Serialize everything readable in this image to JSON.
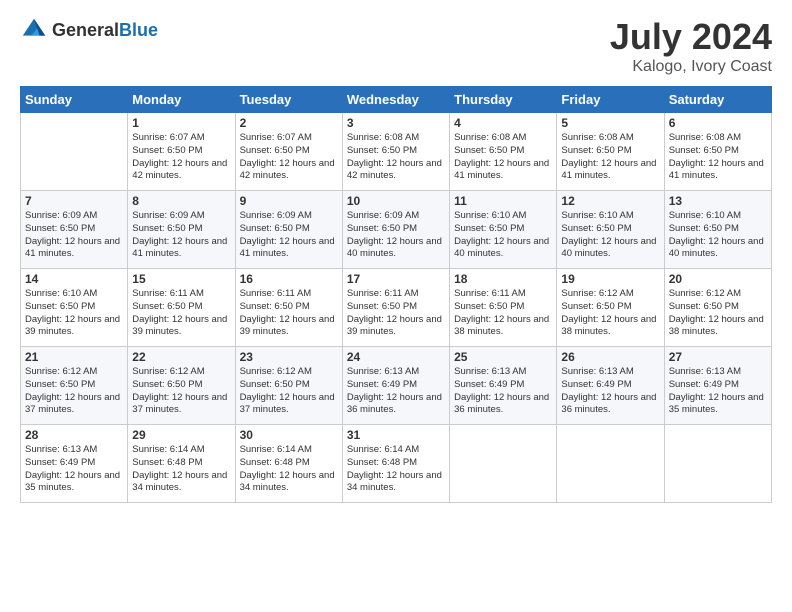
{
  "header": {
    "logo_general": "General",
    "logo_blue": "Blue",
    "month_year": "July 2024",
    "location": "Kalogo, Ivory Coast"
  },
  "days_of_week": [
    "Sunday",
    "Monday",
    "Tuesday",
    "Wednesday",
    "Thursday",
    "Friday",
    "Saturday"
  ],
  "weeks": [
    [
      {
        "day": "",
        "sunrise": "",
        "sunset": "",
        "daylight": ""
      },
      {
        "day": "1",
        "sunrise": "6:07 AM",
        "sunset": "6:50 PM",
        "daylight": "12 hours and 42 minutes."
      },
      {
        "day": "2",
        "sunrise": "6:07 AM",
        "sunset": "6:50 PM",
        "daylight": "12 hours and 42 minutes."
      },
      {
        "day": "3",
        "sunrise": "6:08 AM",
        "sunset": "6:50 PM",
        "daylight": "12 hours and 42 minutes."
      },
      {
        "day": "4",
        "sunrise": "6:08 AM",
        "sunset": "6:50 PM",
        "daylight": "12 hours and 41 minutes."
      },
      {
        "day": "5",
        "sunrise": "6:08 AM",
        "sunset": "6:50 PM",
        "daylight": "12 hours and 41 minutes."
      },
      {
        "day": "6",
        "sunrise": "6:08 AM",
        "sunset": "6:50 PM",
        "daylight": "12 hours and 41 minutes."
      }
    ],
    [
      {
        "day": "7",
        "sunrise": "6:09 AM",
        "sunset": "6:50 PM",
        "daylight": "12 hours and 41 minutes."
      },
      {
        "day": "8",
        "sunrise": "6:09 AM",
        "sunset": "6:50 PM",
        "daylight": "12 hours and 41 minutes."
      },
      {
        "day": "9",
        "sunrise": "6:09 AM",
        "sunset": "6:50 PM",
        "daylight": "12 hours and 41 minutes."
      },
      {
        "day": "10",
        "sunrise": "6:09 AM",
        "sunset": "6:50 PM",
        "daylight": "12 hours and 40 minutes."
      },
      {
        "day": "11",
        "sunrise": "6:10 AM",
        "sunset": "6:50 PM",
        "daylight": "12 hours and 40 minutes."
      },
      {
        "day": "12",
        "sunrise": "6:10 AM",
        "sunset": "6:50 PM",
        "daylight": "12 hours and 40 minutes."
      },
      {
        "day": "13",
        "sunrise": "6:10 AM",
        "sunset": "6:50 PM",
        "daylight": "12 hours and 40 minutes."
      }
    ],
    [
      {
        "day": "14",
        "sunrise": "6:10 AM",
        "sunset": "6:50 PM",
        "daylight": "12 hours and 39 minutes."
      },
      {
        "day": "15",
        "sunrise": "6:11 AM",
        "sunset": "6:50 PM",
        "daylight": "12 hours and 39 minutes."
      },
      {
        "day": "16",
        "sunrise": "6:11 AM",
        "sunset": "6:50 PM",
        "daylight": "12 hours and 39 minutes."
      },
      {
        "day": "17",
        "sunrise": "6:11 AM",
        "sunset": "6:50 PM",
        "daylight": "12 hours and 39 minutes."
      },
      {
        "day": "18",
        "sunrise": "6:11 AM",
        "sunset": "6:50 PM",
        "daylight": "12 hours and 38 minutes."
      },
      {
        "day": "19",
        "sunrise": "6:12 AM",
        "sunset": "6:50 PM",
        "daylight": "12 hours and 38 minutes."
      },
      {
        "day": "20",
        "sunrise": "6:12 AM",
        "sunset": "6:50 PM",
        "daylight": "12 hours and 38 minutes."
      }
    ],
    [
      {
        "day": "21",
        "sunrise": "6:12 AM",
        "sunset": "6:50 PM",
        "daylight": "12 hours and 37 minutes."
      },
      {
        "day": "22",
        "sunrise": "6:12 AM",
        "sunset": "6:50 PM",
        "daylight": "12 hours and 37 minutes."
      },
      {
        "day": "23",
        "sunrise": "6:12 AM",
        "sunset": "6:50 PM",
        "daylight": "12 hours and 37 minutes."
      },
      {
        "day": "24",
        "sunrise": "6:13 AM",
        "sunset": "6:49 PM",
        "daylight": "12 hours and 36 minutes."
      },
      {
        "day": "25",
        "sunrise": "6:13 AM",
        "sunset": "6:49 PM",
        "daylight": "12 hours and 36 minutes."
      },
      {
        "day": "26",
        "sunrise": "6:13 AM",
        "sunset": "6:49 PM",
        "daylight": "12 hours and 36 minutes."
      },
      {
        "day": "27",
        "sunrise": "6:13 AM",
        "sunset": "6:49 PM",
        "daylight": "12 hours and 35 minutes."
      }
    ],
    [
      {
        "day": "28",
        "sunrise": "6:13 AM",
        "sunset": "6:49 PM",
        "daylight": "12 hours and 35 minutes."
      },
      {
        "day": "29",
        "sunrise": "6:14 AM",
        "sunset": "6:48 PM",
        "daylight": "12 hours and 34 minutes."
      },
      {
        "day": "30",
        "sunrise": "6:14 AM",
        "sunset": "6:48 PM",
        "daylight": "12 hours and 34 minutes."
      },
      {
        "day": "31",
        "sunrise": "6:14 AM",
        "sunset": "6:48 PM",
        "daylight": "12 hours and 34 minutes."
      },
      {
        "day": "",
        "sunrise": "",
        "sunset": "",
        "daylight": ""
      },
      {
        "day": "",
        "sunrise": "",
        "sunset": "",
        "daylight": ""
      },
      {
        "day": "",
        "sunrise": "",
        "sunset": "",
        "daylight": ""
      }
    ]
  ]
}
